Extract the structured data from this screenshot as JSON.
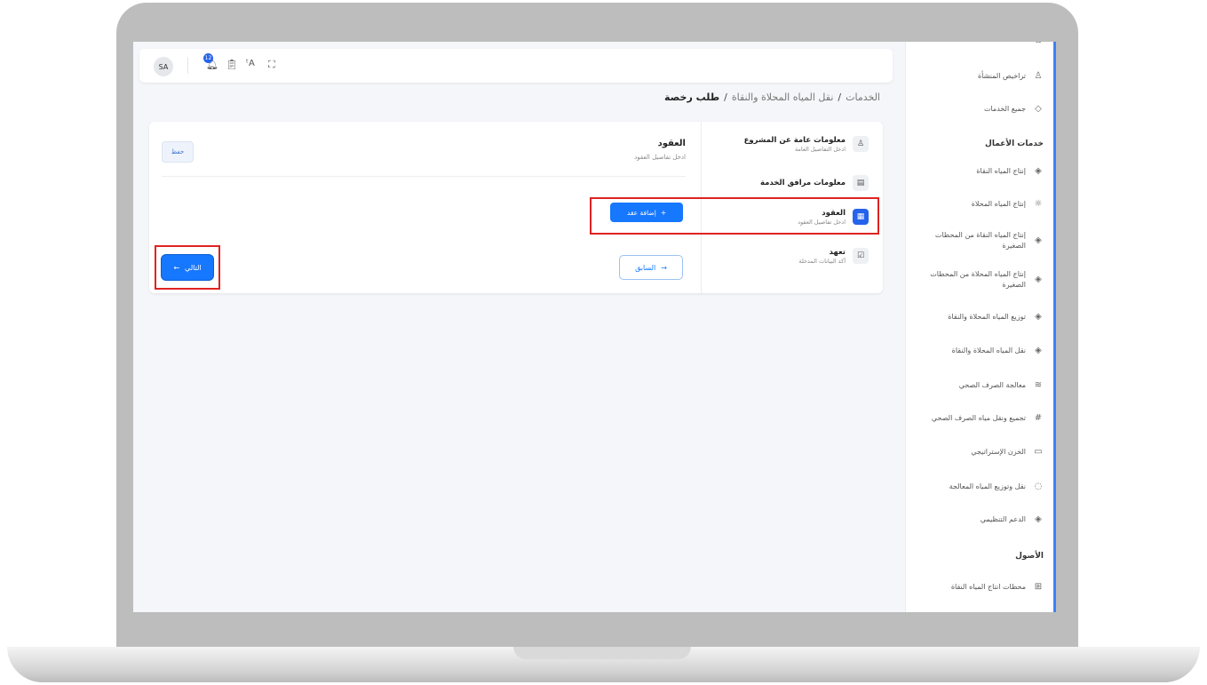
{
  "topbar": {
    "avatar": "SA",
    "notif_count": "12",
    "icons": [
      "bell-icon",
      "clipboard-check-icon",
      "translate-icon",
      "fullscreen-icon"
    ]
  },
  "breadcrumb": {
    "items": [
      "الخدمات",
      "نقل المياه المحلاة والنقاة"
    ],
    "current": "طلب رخصة"
  },
  "stepper": [
    {
      "title": "معلومات عامة عن المشروع",
      "subtitle": "ادخل التفاصيل العامة",
      "icon": "user-icon"
    },
    {
      "title": "معلومات مرافق الخدمة",
      "subtitle": "",
      "icon": "id-card-icon"
    },
    {
      "title": "العقود",
      "subtitle": "ادخل تفاصيل العقود",
      "icon": "document-icon"
    },
    {
      "title": "تعهد",
      "subtitle": "أكد البيانات المدخلة",
      "icon": "checkbox-icon"
    }
  ],
  "main": {
    "title": "العقود",
    "subtitle": "ادخل تفاصيل العقود",
    "save_label": "حفظ",
    "add_label": "إضافة عقد",
    "prev_label": "السابق",
    "next_label": "التالي"
  },
  "sidebar": {
    "top_items": [
      {
        "label": "تراخيص المنشأة",
        "icon": "user-icon"
      },
      {
        "label": "جميع الخدمات",
        "icon": "drop-icon"
      }
    ],
    "section1": "خدمات الأعمال",
    "services": [
      {
        "label": "إنتاج المياه النقاة",
        "icon": "drop-icon"
      },
      {
        "label": "إنتاج المياه المحلاة",
        "icon": "sun-icon"
      },
      {
        "label": "إنتاج المياه النقاة من المحطات الصغيرة",
        "icon": "drop-icon"
      },
      {
        "label": "إنتاج المياه المحلاة من المحطات الصغيرة",
        "icon": "drop-icon"
      },
      {
        "label": "توزيع المياه المحلاة والنقاة",
        "icon": "drop-icon"
      },
      {
        "label": "نقل المياه المحلاة والنقاة",
        "icon": "drop-icon"
      },
      {
        "label": "معالجة الصرف الصحي",
        "icon": "waves-icon"
      },
      {
        "label": "تجميع ونقل مياه الصرف الصحي",
        "icon": "grid-icon"
      },
      {
        "label": "الخزن الإستراتيجي",
        "icon": "storage-icon"
      },
      {
        "label": "نقل وتوزيع المياه المعالجة",
        "icon": "drop-icon"
      },
      {
        "label": "الدعم التنظيمي",
        "icon": "drop-icon"
      }
    ],
    "section2": "الأصول",
    "assets": [
      {
        "label": "محطات انتاج المياه النقاة",
        "icon": "table-icon"
      }
    ]
  },
  "colors": {
    "primary": "#1677ff",
    "highlight": "#e02222",
    "laptop": "#bdbdbd"
  }
}
